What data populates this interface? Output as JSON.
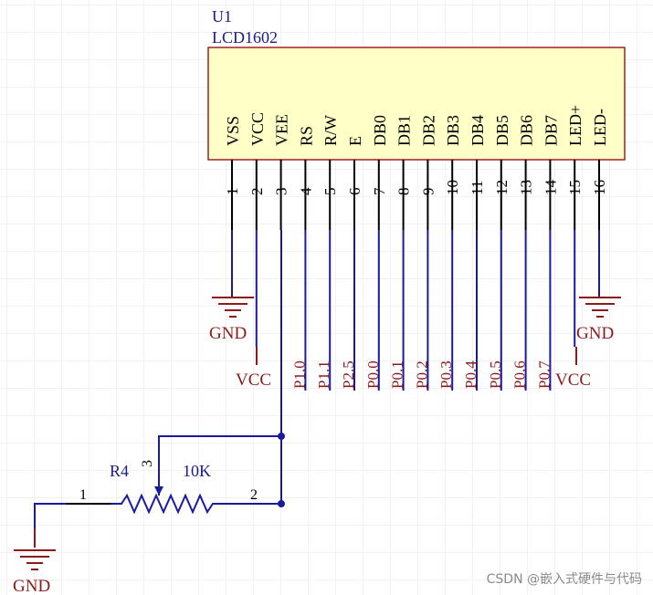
{
  "colors": {
    "grid": "#e4e4e4",
    "body_fill": "#ffffc8",
    "body_stroke": "#a02020",
    "pin": "#000000",
    "wire": "#1a1aa0",
    "label_red": "#8b1a1a",
    "label_blue": "#1a1a8b",
    "power": "#8b1a1a"
  },
  "component": {
    "designator": "U1",
    "value": "LCD1602",
    "pins": [
      {
        "num": "1",
        "name": "VSS",
        "net": "GND"
      },
      {
        "num": "2",
        "name": "VCC",
        "net": "VCC"
      },
      {
        "num": "3",
        "name": "VEE",
        "net": ""
      },
      {
        "num": "4",
        "name": "RS",
        "net": "P1.0"
      },
      {
        "num": "5",
        "name": "R/W",
        "net": "P1.1"
      },
      {
        "num": "6",
        "name": "E",
        "net": "P2.5"
      },
      {
        "num": "7",
        "name": "DB0",
        "net": "P0.0"
      },
      {
        "num": "8",
        "name": "DB1",
        "net": "P0.1"
      },
      {
        "num": "9",
        "name": "DB2",
        "net": "P0.2"
      },
      {
        "num": "10",
        "name": "DB3",
        "net": "P0.3"
      },
      {
        "num": "11",
        "name": "DB4",
        "net": "P0.4"
      },
      {
        "num": "12",
        "name": "DB5",
        "net": "P0.5"
      },
      {
        "num": "13",
        "name": "DB6",
        "net": "P0.6"
      },
      {
        "num": "14",
        "name": "DB7",
        "net": "P0.7"
      },
      {
        "num": "15",
        "name": "LED+",
        "net": "VCC"
      },
      {
        "num": "16",
        "name": "LED-",
        "net": "GND"
      }
    ]
  },
  "potentiometer": {
    "designator": "R4",
    "value": "10K",
    "pin1": "1",
    "pin2": "2",
    "pin3": "3"
  },
  "power": {
    "gnd": "GND",
    "vcc": "VCC"
  },
  "watermark": "CSDN @嵌入式硬件与代码"
}
